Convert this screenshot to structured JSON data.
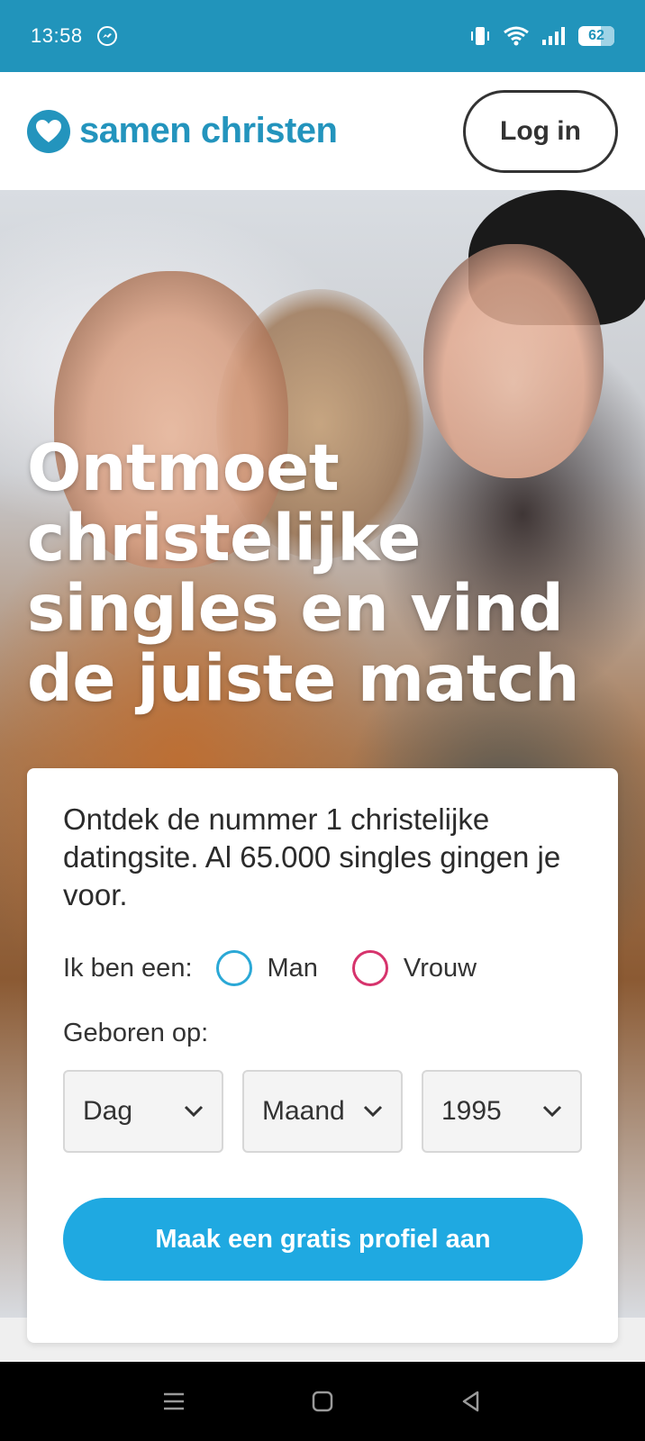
{
  "status_bar": {
    "time": "13:58",
    "battery_level": "62",
    "icons": [
      "messenger-icon",
      "vibrate-icon",
      "wifi-icon",
      "signal-icon",
      "battery-icon"
    ]
  },
  "header": {
    "logo_text": "samen christen",
    "login_label": "Log in",
    "brand_color": "#2394bd"
  },
  "hero": {
    "title": "Ontmoet christelijke singles en vind de juiste match"
  },
  "signup_card": {
    "intro": "Ontdek de nummer 1 christelijke datingsite. Al 65.000 singles gingen je voor.",
    "gender_label": "Ik ben een:",
    "gender_options": [
      "Man",
      "Vrouw"
    ],
    "born_label": "Geboren op:",
    "day_select": "Dag",
    "month_select": "Maand",
    "year_select": "1995",
    "cta_label": "Maak een gratis profiel aan",
    "cta_color": "#1fa9e1"
  },
  "nav_bar": {
    "icons": [
      "menu-icon",
      "home-icon",
      "back-icon"
    ]
  }
}
